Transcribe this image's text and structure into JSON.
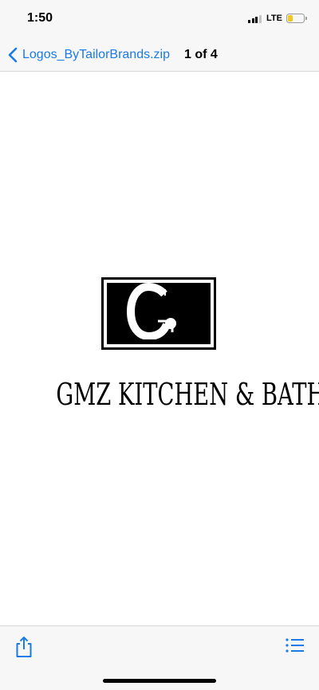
{
  "status_bar": {
    "time": "1:50",
    "network": "LTE",
    "signal_bars": 3,
    "battery_level": 0.3,
    "battery_color": "#f2c81f"
  },
  "nav": {
    "back_icon": "chevron-left-icon",
    "file_name": "Logos_ByTailorBrands.zip",
    "page_counter": "1 of 4",
    "accent_color": "#1a7ae8"
  },
  "logo": {
    "monogram": "G",
    "name": "GMZ KITCHEN & BATH"
  },
  "toolbar": {
    "share_icon": "share-icon",
    "list_icon": "list-icon"
  }
}
